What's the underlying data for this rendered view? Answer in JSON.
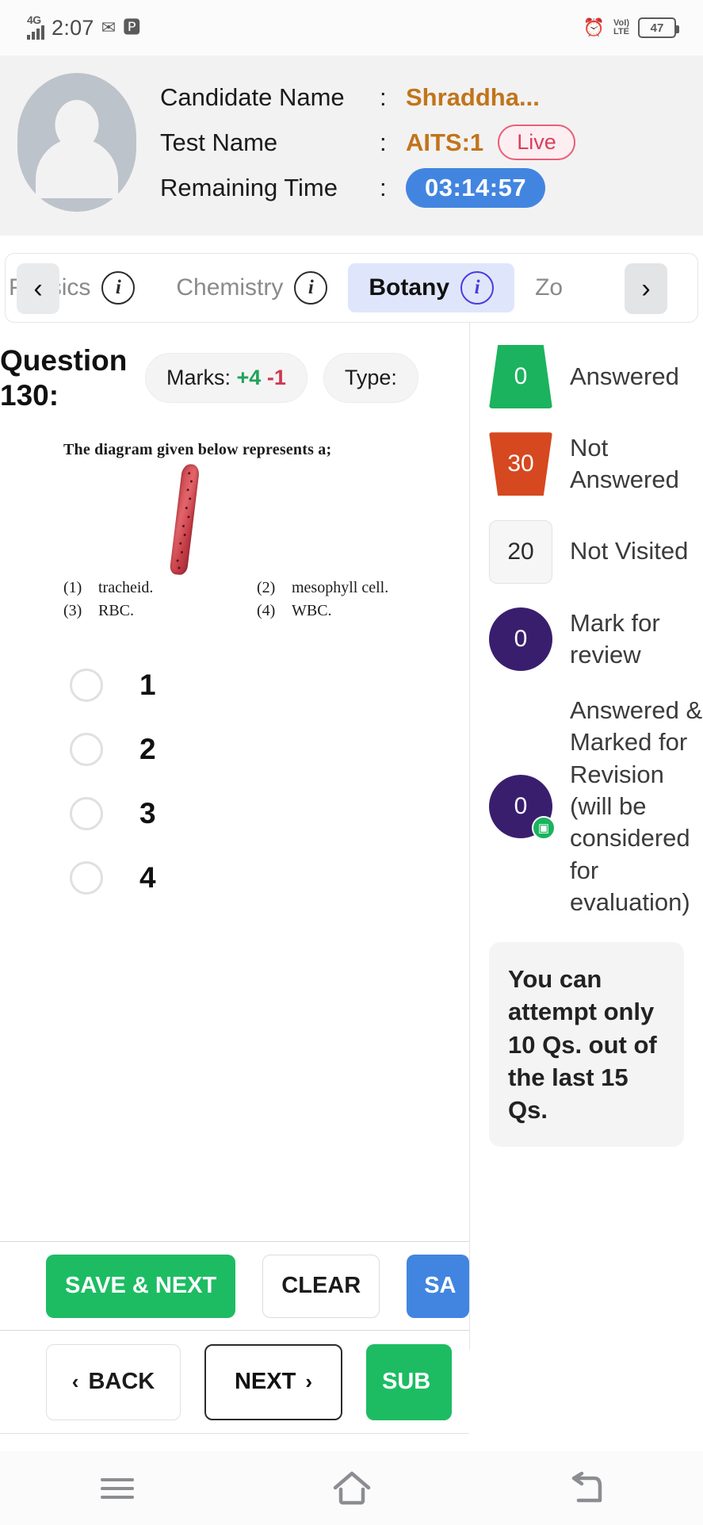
{
  "status_bar": {
    "network": "4G",
    "time": "2:07",
    "mail_icon": "mail-icon",
    "facebook_icon": "facebook-icon",
    "alarm_icon": "alarm-clock-icon",
    "volte_line1": "VoI)",
    "volte_line2": "LTE",
    "battery_level": "47"
  },
  "header": {
    "avatar": "user-avatar-placeholder",
    "rows": [
      {
        "label": "Candidate Name",
        "colon": ":",
        "value": "Shraddha..."
      },
      {
        "label": "Test Name",
        "colon": ":",
        "value": "AITS:1",
        "badge": "Live"
      },
      {
        "label": "Remaining Time",
        "colon": ":",
        "value": "03:14:57"
      }
    ]
  },
  "subject_tabs": {
    "prev_arrow": "‹",
    "next_arrow": "›",
    "items": [
      {
        "label": "Physics",
        "info": "i",
        "active": false
      },
      {
        "label": "Chemistry",
        "info": "i",
        "active": false
      },
      {
        "label": "Botany",
        "info": "i",
        "active": true
      },
      {
        "label": "Zo",
        "info": "",
        "active": false
      }
    ]
  },
  "question": {
    "number_label": "Question 130:",
    "marks_label": "Marks:",
    "marks_positive": "+4",
    "marks_negative": "-1",
    "type_label": "Type:",
    "stem": "The diagram given below represents a;",
    "figure": "elongated-red-cell-diagram",
    "printed_options": [
      {
        "num": "(1)",
        "text": "tracheid."
      },
      {
        "num": "(2)",
        "text": "mesophyll cell."
      },
      {
        "num": "(3)",
        "text": "RBC."
      },
      {
        "num": "(4)",
        "text": "WBC."
      }
    ],
    "choices": [
      {
        "label": "1",
        "selected": false
      },
      {
        "label": "2",
        "selected": false
      },
      {
        "label": "3",
        "selected": false
      },
      {
        "label": "4",
        "selected": false
      }
    ]
  },
  "legend": {
    "items": [
      {
        "count": "0",
        "text": "Answered",
        "shape": "trapezoid-green",
        "color": "#1bb35e"
      },
      {
        "count": "30",
        "text": "Not Answered",
        "shape": "trapezoid-orange",
        "color": "#d6481f"
      },
      {
        "count": "20",
        "text": "Not Visited",
        "shape": "square-gray",
        "color": "#f6f6f7"
      },
      {
        "count": "0",
        "text": "Mark for review",
        "shape": "circle-purple",
        "color": "#3a1e6e"
      },
      {
        "count": "0",
        "text": "Answered & Marked for Revision (will be considered for evaluation)",
        "shape": "circle-purple-badge",
        "color": "#3a1e6e",
        "badge_icon": "document-icon"
      }
    ],
    "note": "You can attempt only 10 Qs. out of the last 15 Qs."
  },
  "actions": {
    "save_next": "SAVE & NEXT",
    "clear": "CLEAR",
    "save_mark": "SA",
    "back": "BACK",
    "back_chevron": "‹",
    "next": "NEXT",
    "next_chevron": "›",
    "submit": "SUB"
  },
  "android_nav": {
    "recents": "menu-icon",
    "home": "home-icon",
    "back": "back-icon"
  }
}
